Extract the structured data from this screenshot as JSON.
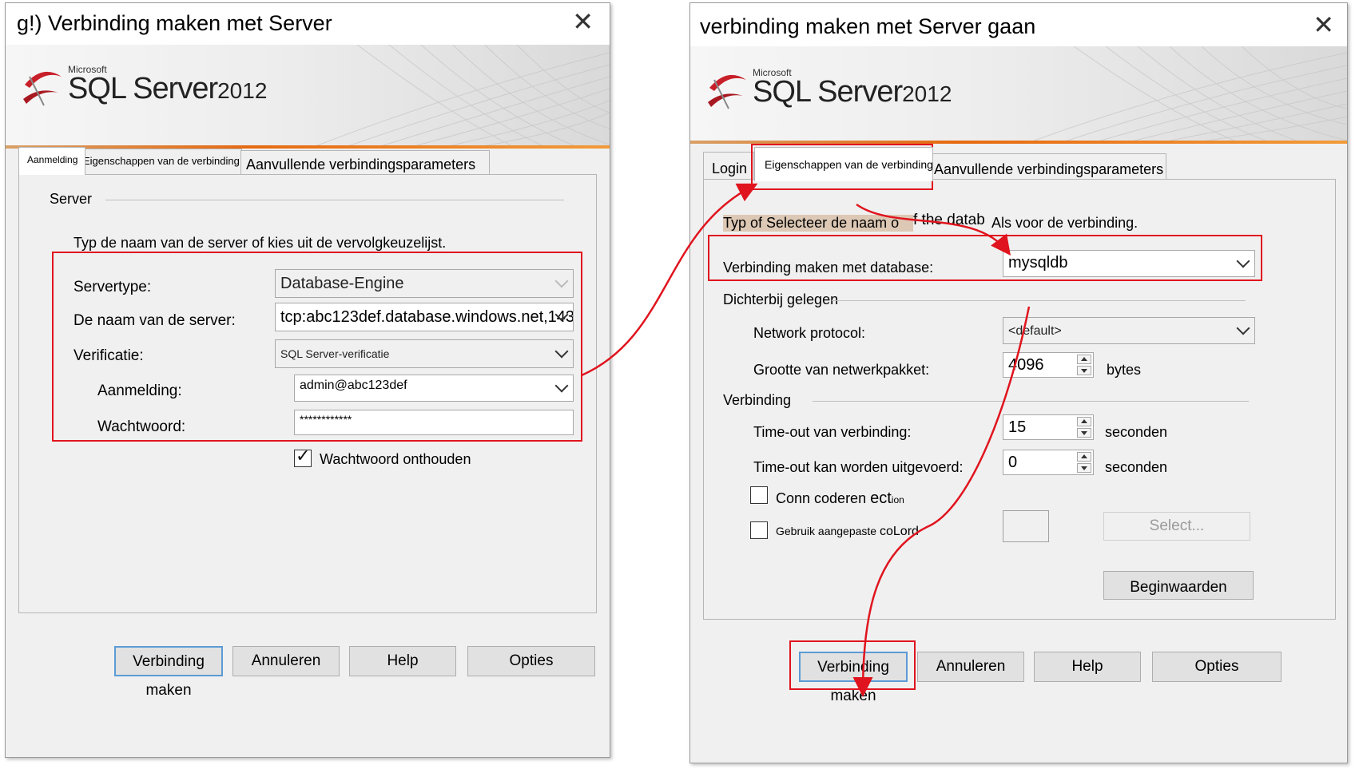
{
  "d1": {
    "title": "g!) Verbinding maken met Server",
    "logo": {
      "microsoft": "Microsoft",
      "sql": "SQL Server",
      "year": "2012"
    },
    "tabs": [
      "Aanmelding",
      "Eigenschappen van de verbinding",
      "Aanvullende verbindingsparameters"
    ],
    "group": "Server",
    "instruction": "Typ de naam van de server of kies uit de vervolgkeuzelijst.",
    "fields": {
      "servertype_label": "Servertype:",
      "servertype_value": "Database-Engine",
      "servername_label": "De naam van de server:",
      "servername_value": "tcp:abc123def.database.windows.net,1433",
      "auth_label": "Verificatie:",
      "auth_value": "SQL Server-verificatie",
      "login_label": "Aanmelding:",
      "login_value": "admin@abc123def",
      "password_label": "Wachtwoord:",
      "password_value": "************"
    },
    "remember": "Wachtwoord onthouden",
    "buttons": {
      "connect": "Verbinding maken",
      "cancel": "Annuleren",
      "help": "Help",
      "options": "Opties"
    }
  },
  "d2": {
    "title": "verbinding maken met Server gaan",
    "logo": {
      "microsoft": "Microsoft",
      "sql": "SQL Server",
      "year": "2012"
    },
    "tabs": [
      "Login",
      "Eigenschappen van de verbinding",
      "Aanvullende verbindingsparameters"
    ],
    "instruction_a": "Typ of Selecteer de naam o",
    "instruction_b": "f the datab",
    "instruction_c": "Als voor de verbinding.",
    "db_label": "Verbinding maken met database:",
    "db_value": "mysqldb",
    "group_near": "Dichterbij gelegen",
    "protocol_label": "Network protocol:",
    "protocol_value": "<default>",
    "packet_label": "Grootte van netwerkpakket:",
    "packet_value": "4096",
    "packet_unit": "bytes",
    "group_conn": "Verbinding",
    "timeout_label": "Time-out van verbinding:",
    "timeout_value": "15",
    "timeout_unit": "seconden",
    "exec_label": "Time-out kan worden uitgevoerd:",
    "exec_value": "0",
    "exec_unit": "seconden",
    "encrypt_label_a": "Conn coderen ",
    "encrypt_label_b": "ect",
    "encrypt_label_c": "ion",
    "custom_label_a": "Gebruik aangepaste ",
    "custom_label_b": "co",
    "custom_label_c": "Lord",
    "select_btn": "Select...",
    "reset_btn": "Beginwaarden",
    "buttons": {
      "connect": "Verbinding maken",
      "cancel": "Annuleren",
      "help": "Help",
      "options": "Opties"
    }
  },
  "colors": {
    "highlight": "#e0141e",
    "focus_blue": "#5b9bd5",
    "banner_orange": "#e66a12"
  }
}
